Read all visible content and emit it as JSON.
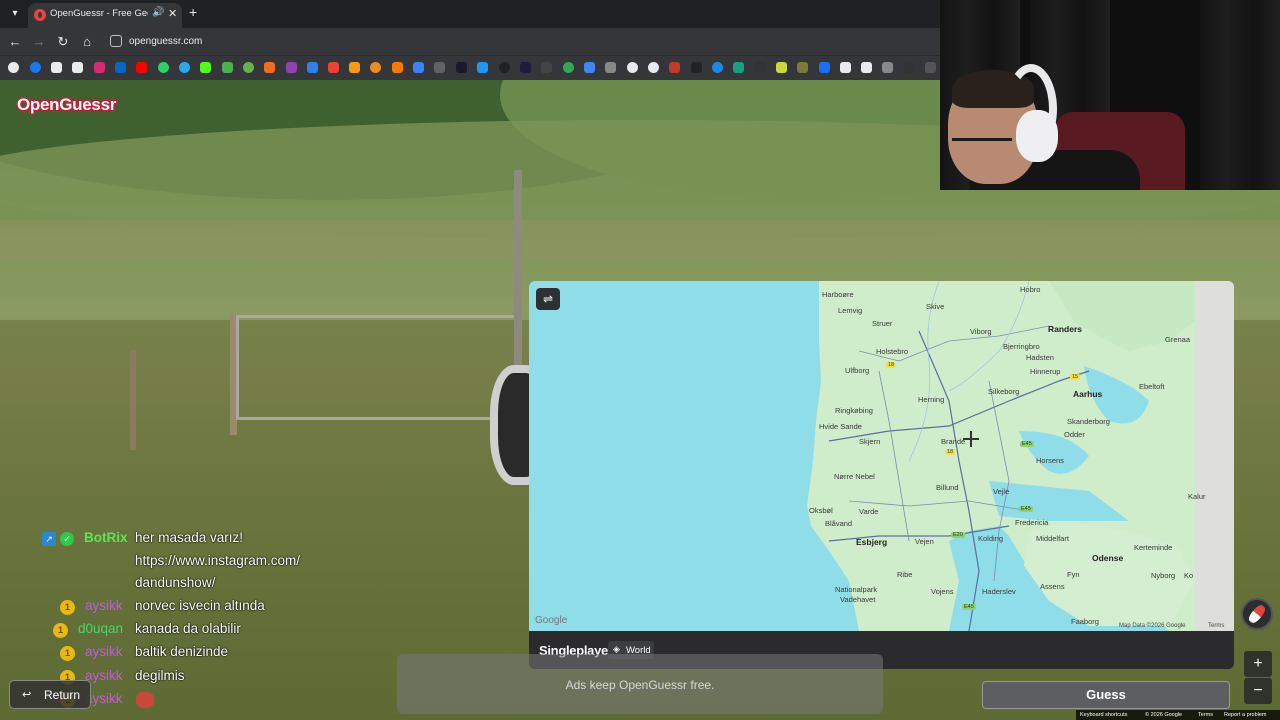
{
  "browser": {
    "tab_title": "OpenGuessr - Free GeoGuessr",
    "url": "openguessr.com"
  },
  "logo": "OpenGuessr",
  "chat": [
    {
      "user": "BotRix",
      "user_color": "#5be35b",
      "lines": [
        "her masada varız!",
        "https://www.instagram.com/",
        "dandunshow/"
      ]
    },
    {
      "user": "aysikk",
      "user_color": "#c15dd9",
      "lines": [
        "norvec isvecin altında"
      ]
    },
    {
      "user": "d0uqan",
      "user_color": "#4fd26d",
      "lines": [
        "kanada da olabilir"
      ]
    },
    {
      "user": "aysikk",
      "user_color": "#c15dd9",
      "lines": [
        "baltik denizinde"
      ]
    },
    {
      "user": "aysikk",
      "user_color": "#c15dd9",
      "lines": [
        "degilmis"
      ]
    },
    {
      "user": "aysikk",
      "user_color": "#c15dd9",
      "lines": [
        ""
      ]
    }
  ],
  "badge_number": "1",
  "map": {
    "places": [
      {
        "name": "Harboøre"
      },
      {
        "name": "Skive"
      },
      {
        "name": "Hobro"
      },
      {
        "name": "Lemvig"
      },
      {
        "name": "Struer"
      },
      {
        "name": "Viborg"
      },
      {
        "name": "Randers"
      },
      {
        "name": "Grenaa"
      },
      {
        "name": "Holstebro"
      },
      {
        "name": "Bjerringbro"
      },
      {
        "name": "Hadsten"
      },
      {
        "name": "Ulfborg"
      },
      {
        "name": "Hinnerup"
      },
      {
        "name": "Ebeltoft"
      },
      {
        "name": "Silkeborg"
      },
      {
        "name": "Aarhus"
      },
      {
        "name": "Herning"
      },
      {
        "name": "Ringkøbing"
      },
      {
        "name": "Skanderborg"
      },
      {
        "name": "Hvide Sande"
      },
      {
        "name": "Odder"
      },
      {
        "name": "Skjern"
      },
      {
        "name": "Brande"
      },
      {
        "name": "Horsens"
      },
      {
        "name": "Nørre Nebel"
      },
      {
        "name": "Billund"
      },
      {
        "name": "Vejle"
      },
      {
        "name": "Kalur"
      },
      {
        "name": "Oksbøl"
      },
      {
        "name": "Varde"
      },
      {
        "name": "Fredericia"
      },
      {
        "name": "Blåvand"
      },
      {
        "name": "Esbjerg"
      },
      {
        "name": "Vejen"
      },
      {
        "name": "Kolding"
      },
      {
        "name": "Middelfart"
      },
      {
        "name": "Kerteminde"
      },
      {
        "name": "Odense"
      },
      {
        "name": "Ribe"
      },
      {
        "name": "Fyn"
      },
      {
        "name": "Nyborg"
      },
      {
        "name": "Ko"
      },
      {
        "name": "Nationalpark"
      },
      {
        "name": "Vadehavet"
      },
      {
        "name": "Vojens"
      },
      {
        "name": "Haderslev"
      },
      {
        "name": "Assens"
      },
      {
        "name": "Faaborg"
      }
    ],
    "road_badges": [
      "18",
      "15",
      "E45",
      "18",
      "E20",
      "E45",
      "E45"
    ],
    "google_logo": "Google",
    "attribution": "Map Data ©2026 Google",
    "terms": "Terms"
  },
  "map_footer": {
    "mode": "Singleplayer",
    "region": "World"
  },
  "ad_text": "Ads keep OpenGuessr free.",
  "return_label": "Return",
  "guess_label": "Guess",
  "zoom_in": "+",
  "zoom_out": "−",
  "footer": {
    "shortcuts": "Keyboard shortcuts",
    "copyright": "© 2026 Google",
    "terms": "Terms",
    "report": "Report a problem"
  }
}
